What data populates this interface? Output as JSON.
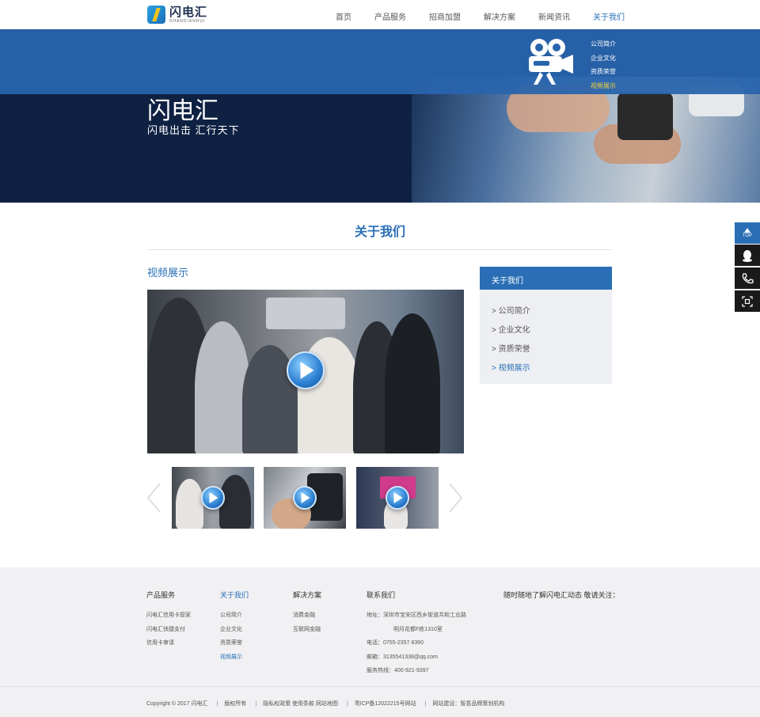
{
  "brand": {
    "name_cn": "闪电汇",
    "name_en": "SHANDIANHUI"
  },
  "nav": [
    {
      "label": "首页",
      "active": false
    },
    {
      "label": "产品服务",
      "active": false
    },
    {
      "label": "招商加盟",
      "active": false
    },
    {
      "label": "解决方案",
      "active": false
    },
    {
      "label": "新闻资讯",
      "active": false
    },
    {
      "label": "关于我们",
      "active": true
    }
  ],
  "banner": {
    "title": "闪电汇",
    "subtitle": "闪电出击  汇行天下",
    "camera_icon": "video-camera-icon",
    "submenu": [
      "公司简介",
      "企业文化",
      "资质荣誉",
      "视频展示"
    ],
    "submenu_active_index": 3
  },
  "section": {
    "title": "关于我们"
  },
  "video": {
    "heading": "视频展示",
    "play_icon": "play-button-icon",
    "thumbnails": 3
  },
  "sidebar": {
    "title": "关于我们",
    "items": [
      "> 公司简介",
      "> 企业文化",
      "> 资质荣誉",
      "> 视频展示"
    ],
    "active_index": 3
  },
  "float_tools": {
    "top_label": "TOP",
    "icons": [
      "qq-icon",
      "phone-icon",
      "qr-code-icon"
    ]
  },
  "footer": {
    "columns": [
      {
        "title": "产品服务",
        "items": [
          "闪电汇信用卡管家",
          "闪电汇快捷支付",
          "信用卡审请"
        ]
      },
      {
        "title": "关于我们",
        "items": [
          "公司简介",
          "企业文化",
          "资质荣誉",
          "视频展示"
        ],
        "active": true,
        "active_item": 3
      },
      {
        "title": "解决方案",
        "items": [
          "消费金融",
          "互联网金融"
        ]
      },
      {
        "title": "联系我们",
        "items": [
          "地址：深圳市宝安区西乡街道共和工业路",
          "明月花都F栋1310室",
          "电话：0755-2357 8360",
          "邮箱：3135541338@qq.com",
          "服务热线：400-921-9397"
        ]
      }
    ],
    "follow": "随时随地了解闪电汇动态 敬请关注：",
    "copyright": [
      "Copyright © 2017 闪电汇",
      "版权所有",
      "隐私权政策  使用条款  网站地图",
      "粤ICP备12022215号网站",
      "网站建设：智意品牌策划机构"
    ]
  },
  "colors": {
    "accent": "#2a6fb6",
    "banner_overlay": "#2864ac",
    "highlight": "#f5d33a",
    "footer_bg": "#f1f1f3"
  }
}
